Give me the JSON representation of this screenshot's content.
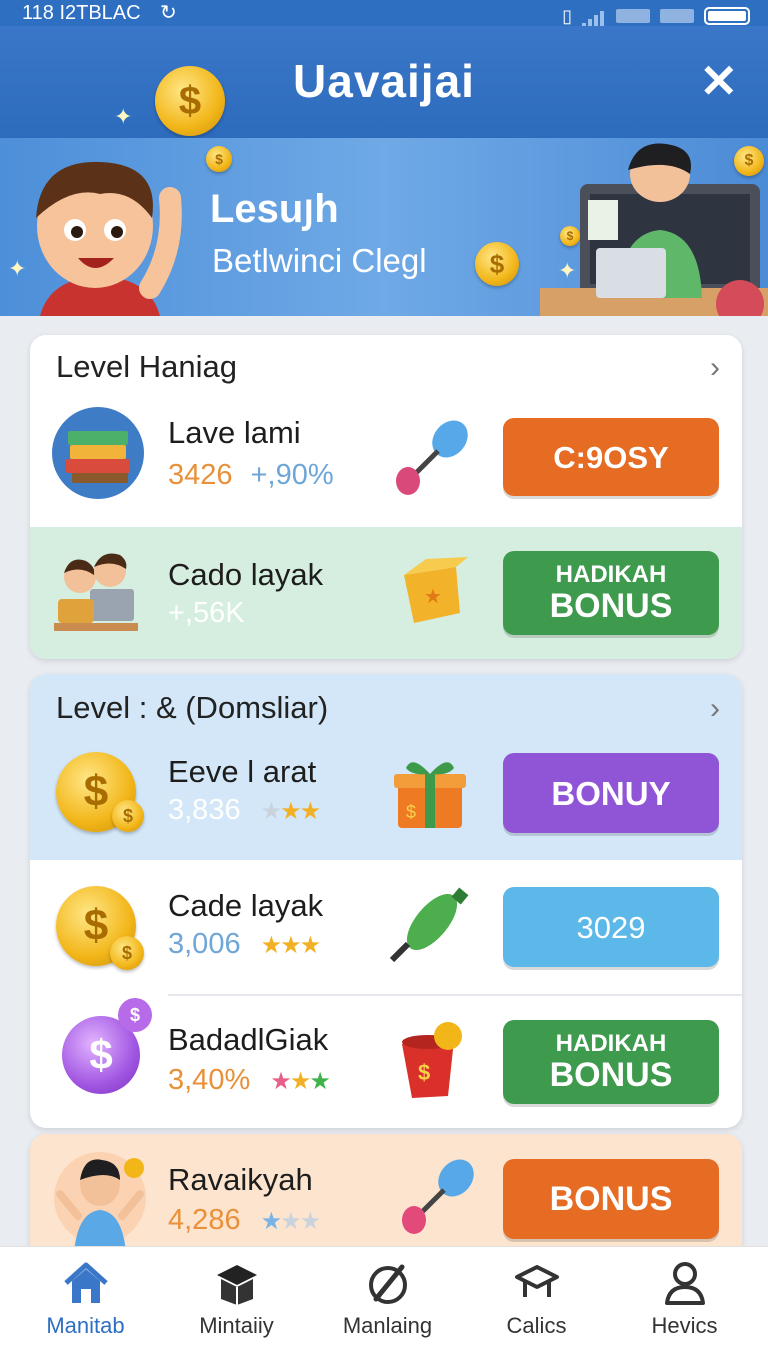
{
  "status": {
    "left": "118 I2TBLAC"
  },
  "header": {
    "title": "Uavaijai",
    "close": "✕"
  },
  "banner": {
    "title": "Lesuյh",
    "subtitle": "Betlwinci Clegl"
  },
  "colors": {
    "primary": "#2f6fc1",
    "orange": "#e66b23",
    "green": "#3e9a4d",
    "purple": "#9054d6",
    "sky": "#5bb8e8"
  },
  "section1": {
    "heading": "Level Haniag",
    "rows": [
      {
        "name": "Lave lami",
        "value": "3426",
        "change": "+,90%",
        "button": "C:9OSY",
        "icon": "books-icon",
        "item_icon": "rattle-icon"
      },
      {
        "name": "Cado layak",
        "value": "+,56K",
        "button_line1": "HADIKAH",
        "button_line2": "BONUS",
        "icon": "kids-computer-icon",
        "item_icon": "gift-box-icon"
      }
    ]
  },
  "section2": {
    "heading": "Level : & (Domsliar)",
    "rows": [
      {
        "name": "Eeve l arat",
        "value": "3,836",
        "rating": 2,
        "button": "BONUY",
        "icon": "coin-stack-icon",
        "item_icon": "gift-icon"
      },
      {
        "name": "Cade layak",
        "value": "3,006",
        "rating": 3,
        "button": "3029",
        "icon": "coin-stack-icon",
        "item_icon": "bottle-icon"
      },
      {
        "name": "BadadlGiak",
        "value": "3,40%",
        "rating": 3,
        "button_line1": "HADIKAH",
        "button_line2": "BONUS",
        "icon": "purple-coin-icon",
        "item_icon": "money-bucket-icon"
      }
    ]
  },
  "section3": {
    "rows": [
      {
        "name": "Ravaikyah",
        "value": "4,286",
        "rating": 1,
        "button": "BONUS",
        "icon": "child-icon",
        "item_icon": "rattle-icon"
      }
    ]
  },
  "nav": {
    "items": [
      {
        "label": "Manitab",
        "icon": "home-icon",
        "active": true
      },
      {
        "label": "Mintaiiy",
        "icon": "box-icon",
        "active": false
      },
      {
        "label": "Manlaing",
        "icon": "pen-circle-icon",
        "active": false
      },
      {
        "label": "Calics",
        "icon": "graduation-cap-icon",
        "active": false
      },
      {
        "label": "Hevics",
        "icon": "person-icon",
        "active": false
      }
    ]
  }
}
